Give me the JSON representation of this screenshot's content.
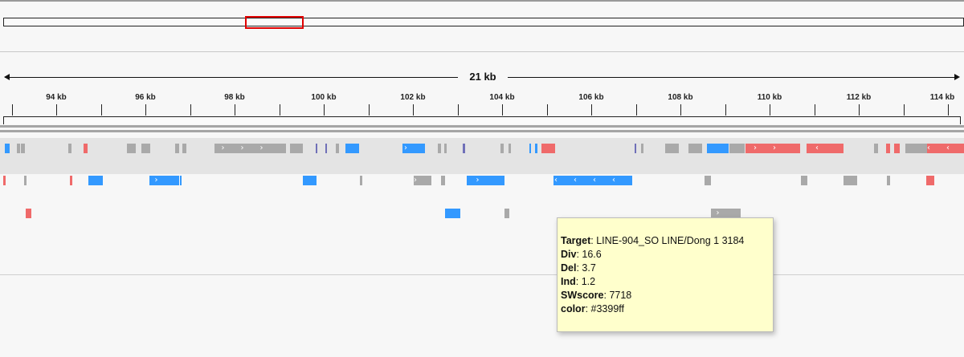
{
  "ruler": {
    "span_label": "21 kb",
    "ticks": [
      "94 kb",
      "96 kb",
      "98 kb",
      "100 kb",
      "102 kb",
      "104 kb",
      "106 kb",
      "108 kb",
      "110 kb",
      "112 kb",
      "114 kb"
    ]
  },
  "colors": {
    "gray": "#a9a9a9",
    "blue": "#3399ff",
    "red": "#ef6a6a",
    "purple": "#7070b8"
  },
  "tooltip": {
    "target_key": "Target",
    "target_value": ": LINE-904_SO LINE/Dong 1 3184",
    "div_key": "Div",
    "div_value": ": 16.6",
    "del_key": "Del",
    "del_value": ": 3.7",
    "ind_key": "Ind",
    "ind_value": ": 1.2",
    "swscore_key": "SWscore",
    "swscore_value": ": 7718",
    "color_key": "color",
    "color_value": ": #3399ff"
  }
}
